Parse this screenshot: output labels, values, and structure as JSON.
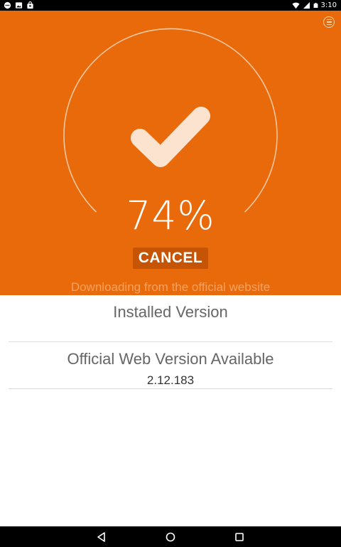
{
  "status_bar": {
    "time": "3:10",
    "left_icons": [
      "chat-bubble-icon",
      "image-icon",
      "shopping-bag-icon"
    ],
    "right_icons": [
      "wifi-icon",
      "cell-signal-icon",
      "battery-icon"
    ]
  },
  "header": {
    "menu_icon": "menu-icon"
  },
  "progress": {
    "percent_label": "74%",
    "percent_value": 74,
    "center_icon": "checkmark-icon"
  },
  "actions": {
    "cancel_label": "CANCEL"
  },
  "status_message": "Downloading from the official website",
  "versions": {
    "installed_label": "Installed Version",
    "official_label": "Official Web Version Available",
    "official_value": "2.12.183"
  },
  "colors": {
    "accent": "#e86a0b",
    "button_bg": "#c55405",
    "status_text": "#f7a25f"
  },
  "nav": {
    "icons": [
      "back-icon",
      "home-icon",
      "recents-icon"
    ]
  }
}
